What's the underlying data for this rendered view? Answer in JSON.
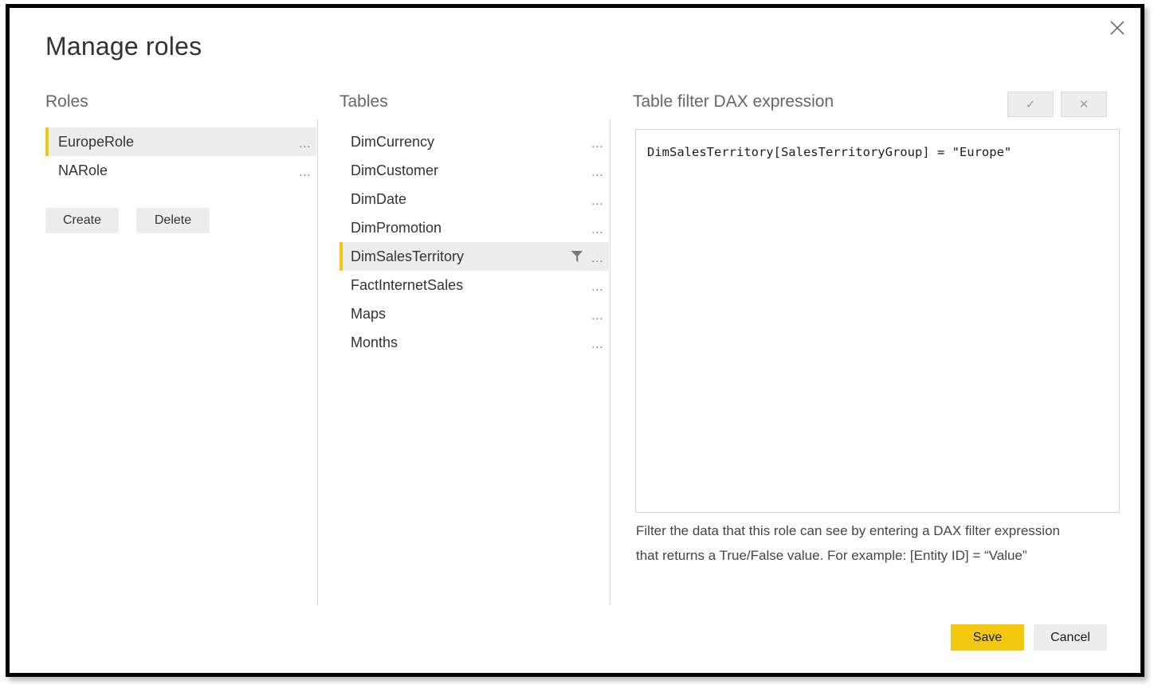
{
  "dialog": {
    "title": "Manage roles",
    "close_label": "×"
  },
  "roles_panel": {
    "heading": "Roles",
    "items": [
      {
        "label": "EuropeRole",
        "selected": true,
        "menu": "…"
      },
      {
        "label": "NARole",
        "selected": false,
        "menu": "…"
      }
    ],
    "create_label": "Create",
    "delete_label": "Delete"
  },
  "tables_panel": {
    "heading": "Tables",
    "items": [
      {
        "label": "DimCurrency",
        "selected": false,
        "filtered": false,
        "menu": "…"
      },
      {
        "label": "DimCustomer",
        "selected": false,
        "filtered": false,
        "menu": "…"
      },
      {
        "label": "DimDate",
        "selected": false,
        "filtered": false,
        "menu": "…"
      },
      {
        "label": "DimPromotion",
        "selected": false,
        "filtered": false,
        "menu": "…"
      },
      {
        "label": "DimSalesTerritory",
        "selected": true,
        "filtered": true,
        "menu": "…"
      },
      {
        "label": "FactInternetSales",
        "selected": false,
        "filtered": false,
        "menu": "…"
      },
      {
        "label": "Maps",
        "selected": false,
        "filtered": false,
        "menu": "…"
      },
      {
        "label": "Months",
        "selected": false,
        "filtered": false,
        "menu": "…"
      }
    ]
  },
  "dax_panel": {
    "heading": "Table filter DAX expression",
    "accept_label": "✓",
    "reject_label": "✕",
    "expression": "DimSalesTerritory[SalesTerritoryGroup] = \"Europe\"",
    "help_line1": "Filter the data that this role can see by entering a DAX filter expression",
    "help_line2": "that returns a True/False value. For example: [Entity ID] = “Value”"
  },
  "footer": {
    "save_label": "Save",
    "cancel_label": "Cancel"
  },
  "colors": {
    "accent_yellow": "#f2c811",
    "selected_row_bg": "#ededed",
    "button_gray": "#ededed",
    "divider": "#d9d9d9",
    "title_text": "#333333",
    "heading_text": "#666666"
  }
}
